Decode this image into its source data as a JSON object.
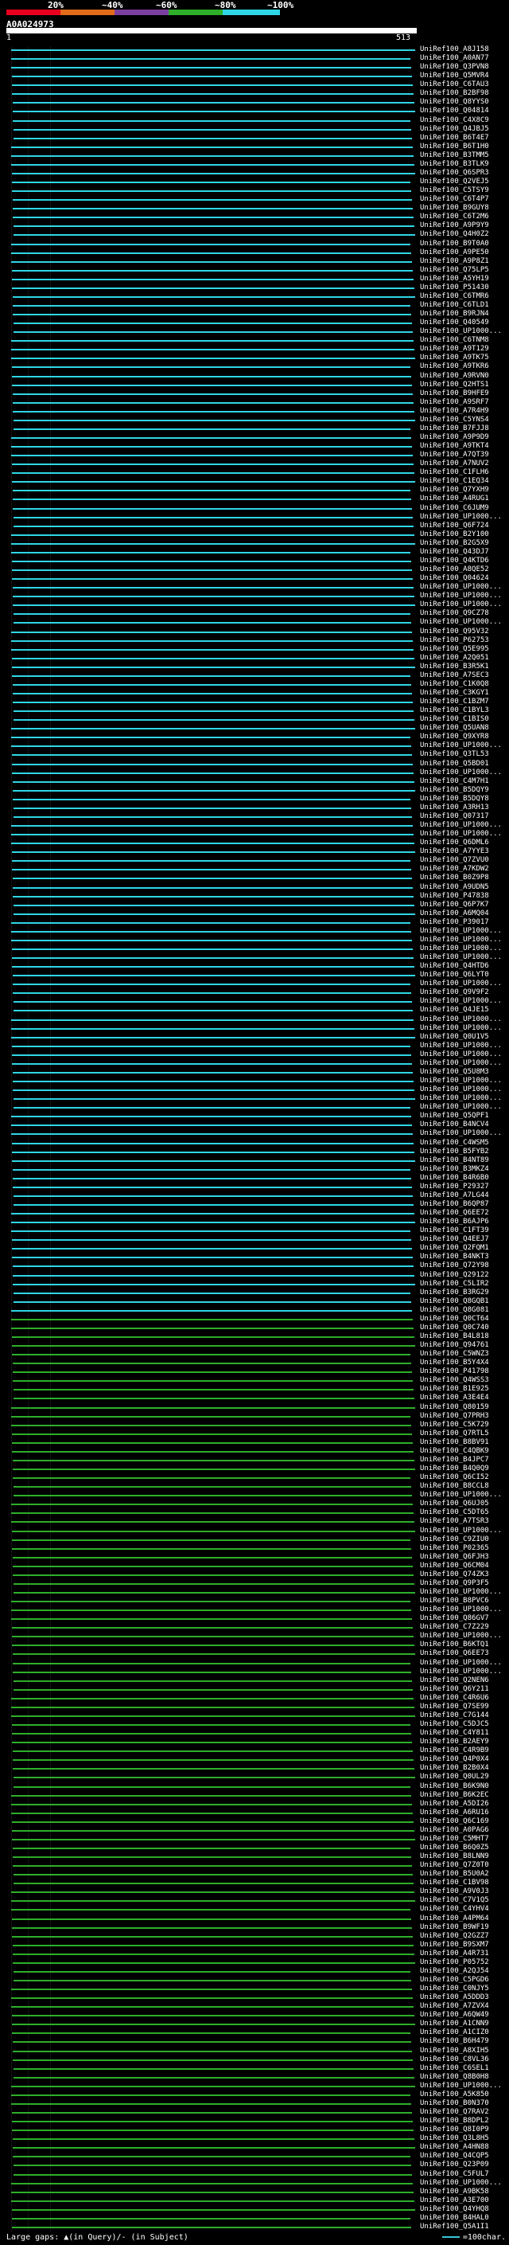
{
  "legend": {
    "labels": [
      "20%",
      "~40%",
      "~60%",
      "~80%",
      "~100%"
    ],
    "colors": [
      "#e8001e",
      "#e26b1a",
      "#7b3fa0",
      "#2eae2a",
      "#2fd6e6"
    ]
  },
  "query": {
    "id": "A0A024973",
    "start": "1",
    "end": "513"
  },
  "footer": {
    "left": "Large gaps: ▲(in Query)/- (in Subject)",
    "right": "=100char."
  },
  "hits": [
    "UniRef100_A8J158",
    "UniRef100_A0AN77",
    "UniRef100_Q3PVN8",
    "UniRef100_Q5MVR4",
    "UniRef100_C6TAU3",
    "UniRef100_B2BF98",
    "UniRef100_Q8YYS0",
    "UniRef100_Q04814",
    "UniRef100_C4X8C9",
    "UniRef100_Q4JBJ5",
    "UniRef100_B6T4E7",
    "UniRef100_B6T1H0",
    "UniRef100_B3TMM5",
    "UniRef100_B3TLK9",
    "UniRef100_Q6SPR3",
    "UniRef100_Q2VEJ5",
    "UniRef100_C5TSY9",
    "UniRef100_C6T4P7",
    "UniRef100_B9GUY8",
    "UniRef100_C6T2M6",
    "UniRef100_A9P9Y9",
    "UniRef100_Q4H0Z2",
    "UniRef100_B9T0A0",
    "UniRef100_A9PE50",
    "UniRef100_A9P8Z1",
    "UniRef100_Q75LP5",
    "UniRef100_A5YH19",
    "UniRef100_P51430",
    "UniRef100_C6TMR6",
    "UniRef100_C6TLD1",
    "UniRef100_B9RJN4",
    "UniRef100_Q40549",
    "UniRef100_UP1000...",
    "UniRef100_C6TNM8",
    "UniRef100_A9T129",
    "UniRef100_A9TK75",
    "UniRef100_A9TKR6",
    "UniRef100_A9RVN0",
    "UniRef100_Q2HTS1",
    "UniRef100_B9HFE9",
    "UniRef100_A9SRF7",
    "UniRef100_A7R4H9",
    "UniRef100_C5YNS4",
    "UniRef100_B7FJJ8",
    "UniRef100_A9P9D9",
    "UniRef100_A9TKT4",
    "UniRef100_A7QT39",
    "UniRef100_A7NUV2",
    "UniRef100_C1FLH6",
    "UniRef100_C1EQ34",
    "UniRef100_Q7YXH9",
    "UniRef100_A4RUG1",
    "UniRef100_C6JUM9",
    "UniRef100_UP1000...",
    "UniRef100_Q6F724",
    "UniRef100_B2Y100",
    "UniRef100_B2G5X9",
    "UniRef100_Q43DJ7",
    "UniRef100_Q4KTD6",
    "UniRef100_A8QE52",
    "UniRef100_Q04624",
    "UniRef100_UP1000...",
    "UniRef100_UP1000...",
    "UniRef100_UP1000...",
    "UniRef100_Q9CZ78",
    "UniRef100_UP1000...",
    "UniRef100_Q95V32",
    "UniRef100_P62753",
    "UniRef100_Q5E995",
    "UniRef100_A2Q051",
    "UniRef100_B3R5K1",
    "UniRef100_A7SEC3",
    "UniRef100_C1K0Q8",
    "UniRef100_C3KGY1",
    "UniRef100_C1BZM7",
    "UniRef100_C1BYL3",
    "UniRef100_C1BIS0",
    "UniRef100_Q5UAN8",
    "UniRef100_Q9XYR8",
    "UniRef100_UP1000...",
    "UniRef100_Q3TL53",
    "UniRef100_Q5BD01",
    "UniRef100_UP1000...",
    "UniRef100_C4M7H1",
    "UniRef100_B5DQY9",
    "UniRef100_B5DQY8",
    "UniRef100_A3RH13",
    "UniRef100_Q07317",
    "UniRef100_UP1000...",
    "UniRef100_UP1000...",
    "UniRef100_Q6DML6",
    "UniRef100_A7YYE3",
    "UniRef100_Q7ZVU0",
    "UniRef100_A7KDW2",
    "UniRef100_B0Z9P8",
    "UniRef100_A9UDN5",
    "UniRef100_P47838",
    "UniRef100_Q6P7K7",
    "UniRef100_A6MQ04",
    "UniRef100_P39017",
    "UniRef100_UP1000...",
    "UniRef100_UP1000...",
    "UniRef100_UP1000...",
    "UniRef100_UP1000...",
    "UniRef100_Q4HTD6",
    "UniRef100_Q6LYT0",
    "UniRef100_UP1000...",
    "UniRef100_Q9V9F2",
    "UniRef100_UP1000...",
    "UniRef100_Q4JE15",
    "UniRef100_UP1000...",
    "UniRef100_UP1000...",
    "UniRef100_Q0U1V5",
    "UniRef100_UP1000...",
    "UniRef100_UP1000...",
    "UniRef100_UP1000...",
    "UniRef100_Q5U8M3",
    "UniRef100_UP1000...",
    "UniRef100_UP1000...",
    "UniRef100_UP1000...",
    "UniRef100_UP1000...",
    "UniRef100_Q5QPF1",
    "UniRef100_B4NCV4",
    "UniRef100_UP1000...",
    "UniRef100_C4WSM5",
    "UniRef100_B5FYB2",
    "UniRef100_B4NT89",
    "UniRef100_B3MKZ4",
    "UniRef100_B4R6B0",
    "UniRef100_P29327",
    "UniRef100_A7LG44",
    "UniRef100_B6QP87",
    "UniRef100_Q6EE72",
    "UniRef100_B6AJP6",
    "UniRef100_C1FT39",
    "UniRef100_Q4EEJ7",
    "UniRef100_Q2FQM1",
    "UniRef100_B4NKT3",
    "UniRef100_Q72Y98",
    "UniRef100_Q29122",
    "UniRef100_C5LIR2",
    "UniRef100_B3RG29",
    "UniRef100_Q8GQB1",
    "UniRef100_Q8G081",
    "UniRef100_Q0CT64",
    "UniRef100_Q0C740",
    "UniRef100_B4L818",
    "UniRef100_Q94761",
    "UniRef100_C5WNZ3",
    "UniRef100_B5Y4X4",
    "UniRef100_P41798",
    "UniRef100_Q4WSS3",
    "UniRef100_B1E925",
    "UniRef100_A3E4E4",
    "UniRef100_Q80159",
    "UniRef100_Q7PRH3",
    "UniRef100_C5K729",
    "UniRef100_Q7RTL5",
    "UniRef100_B8BV91",
    "UniRef100_C4QBK9",
    "UniRef100_B4JPC7",
    "UniRef100_B4Q0Q9",
    "UniRef100_Q6CI52",
    "UniRef100_B8CCL8",
    "UniRef100_UP1000...",
    "UniRef100_Q6UJ05",
    "UniRef100_C5DT65",
    "UniRef100_A7TSR3",
    "UniRef100_UP1000...",
    "UniRef100_C9ZIU0",
    "UniRef100_P02365",
    "UniRef100_Q6FJH3",
    "UniRef100_Q6CM04",
    "UniRef100_Q74ZK3",
    "UniRef100_Q9P3F5",
    "UniRef100_UP1000...",
    "UniRef100_B8PVC6",
    "UniRef100_UP1000...",
    "UniRef100_Q86GV7",
    "UniRef100_C7Z229",
    "UniRef100_UP1000...",
    "UniRef100_B6KTQ1",
    "UniRef100_Q6EE73",
    "UniRef100_UP1000...",
    "UniRef100_UP1000...",
    "UniRef100_Q2NEN6",
    "UniRef100_Q6Y211",
    "UniRef100_C4R6U6",
    "UniRef100_Q7SE99",
    "UniRef100_C7G144",
    "UniRef100_C5DJC5",
    "UniRef100_C4Y811",
    "UniRef100_B2AEY9",
    "UniRef100_C4R9B9",
    "UniRef100_Q4P0X4",
    "UniRef100_B2B0X4",
    "UniRef100_Q0UL29",
    "UniRef100_B6K9N0",
    "UniRef100_B6K2EC",
    "UniRef100_A5DI26",
    "UniRef100_A6RU16",
    "UniRef100_Q6C169",
    "UniRef100_A0PAG6",
    "UniRef100_C5MHT7",
    "UniRef100_B6Q0Z5",
    "UniRef100_B8LNN9",
    "UniRef100_Q7Z0T0",
    "UniRef100_B5U0A2",
    "UniRef100_C1BV98",
    "UniRef100_A9V0J3",
    "UniRef100_C7V1Q5",
    "UniRef100_C4YHV4",
    "UniRef100_A4PM64",
    "UniRef100_B9WF19",
    "UniRef100_Q2GZZ7",
    "UniRef100_B9SXM7",
    "UniRef100_A4R731",
    "UniRef100_P05752",
    "UniRef100_A2QJ54",
    "UniRef100_C5PGD6",
    "UniRef100_C0NJY5",
    "UniRef100_A5DDD3",
    "UniRef100_A7ZVX4",
    "UniRef100_A6QW49",
    "UniRef100_A1CNN9",
    "UniRef100_A1CIZ0",
    "UniRef100_B6H479",
    "UniRef100_A8XIH5",
    "UniRef100_C8VL36",
    "UniRef100_C6SEL1",
    "UniRef100_Q8B0H8",
    "UniRef100_UP1000...",
    "UniRef100_A5K850",
    "UniRef100_B0N370",
    "UniRef100_Q7RAV2",
    "UniRef100_B8DPL2",
    "UniRef100_Q8I0P9",
    "UniRef100_Q3L8H5",
    "UniRef100_A4HN88",
    "UniRef100_Q4CQP5",
    "UniRef100_Q23P09",
    "UniRef100_C5FUL7",
    "UniRef100_UP1000...",
    "UniRef100_A9BK58",
    "UniRef100_A3E700",
    "UniRef100_Q4YHQ8",
    "UniRef100_B4HAL0",
    "UniRef100_Q5A1I1"
  ]
}
